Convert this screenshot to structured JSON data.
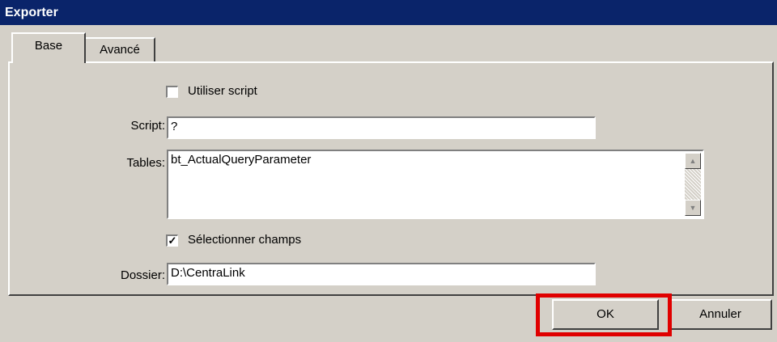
{
  "window": {
    "title": "Exporter"
  },
  "tabs": [
    {
      "label": "Base"
    },
    {
      "label": "Avancé"
    }
  ],
  "form": {
    "use_script": {
      "label": "Utiliser script",
      "checked": false
    },
    "script": {
      "label": "Script:",
      "value": "?"
    },
    "tables": {
      "label": "Tables:",
      "value": "bt_ActualQueryParameter"
    },
    "select_fields": {
      "label": "Sélectionner champs",
      "checked": true
    },
    "folder": {
      "label": "Dossier:",
      "value": "D:\\CentraLink"
    }
  },
  "buttons": {
    "ok": "OK",
    "cancel": "Annuler"
  },
  "annotation": {
    "highlight_color": "#e00000"
  }
}
